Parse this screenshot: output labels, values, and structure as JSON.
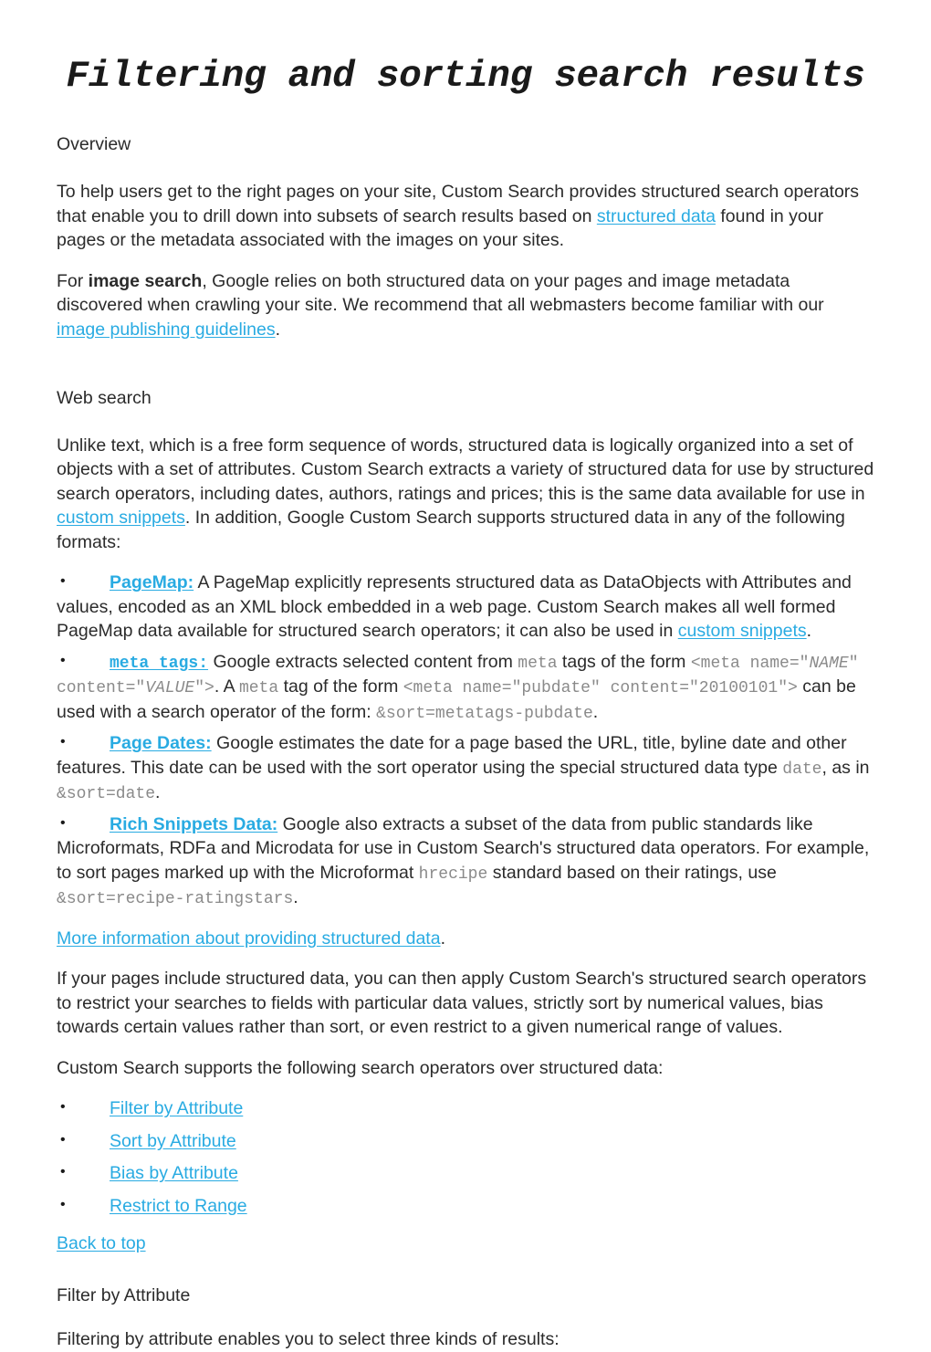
{
  "document": {
    "title": "Filtering and sorting search results"
  },
  "colors": {
    "link": "#29ABE2",
    "text": "#2b2b2b",
    "code": "#8a8a8a",
    "background": "#ffffff"
  },
  "sections": {
    "overview": {
      "heading": "Overview",
      "p1": {
        "a": "To help users get to the right pages on your site, Custom Search provides structured search operators that enable you to drill down into subsets of search results based on ",
        "link": "structured data",
        "b": " found in your pages or the metadata associated with the images on your sites."
      },
      "p2": {
        "a": "For ",
        "bold": "image search",
        "b": ", Google relies on both structured data on your pages and image metadata discovered when crawling your site. We recommend that all webmasters become familiar with our ",
        "link": "image publishing guidelines",
        "c": "."
      }
    },
    "web_search": {
      "heading": "Web search",
      "p1": {
        "a": "Unlike text, which is a free form sequence of words, structured data is logically organized into a set of objects with a set of attributes. Custom Search extracts a variety of structured data for use by structured search operators, including dates, authors, ratings and prices; this is the same data available for use in ",
        "link": "custom snippets",
        "b": ". In addition, Google Custom Search supports structured data in any of the following formats:"
      },
      "bullets": {
        "pagemap": {
          "link": "PageMap:",
          "a": " A PageMap explicitly represents structured data as DataObjects with Attributes and values, encoded as an XML block embedded in a web page. Custom Search makes all well formed PageMap data available for structured search operators; it can also be used in ",
          "link2": "custom snippets",
          "b": "."
        },
        "meta_tags": {
          "link": "meta tags:",
          "a": " Google extracts selected content from ",
          "code1": "meta",
          "b": " tags of the form ",
          "code2": "<meta name=\"",
          "code2i": "NAME",
          "code2b": "\" content=\"",
          "code2i2": "VALUE",
          "code2c": "\">",
          "c": ". A ",
          "code3": "meta",
          "d": " tag of the form ",
          "code4": "<meta name=\"pubdate\" content=\"20100101\">",
          "e": " can be used with a search operator of the form: ",
          "code5": "&sort=metatags-pubdate",
          "f": "."
        },
        "page_dates": {
          "link": "Page Dates:",
          "a": " Google estimates the date for a page based the URL, title, byline date and other features. This date can be used with the sort operator using the special structured data type ",
          "code1": "date",
          "b": ", as in ",
          "code2": "&sort=date",
          "c": "."
        },
        "rich_snippets": {
          "link": "Rich Snippets Data:",
          "a": " Google also extracts a subset of the data from public standards like Microformats, RDFa and Microdata for use in Custom Search's structured data operators. For example, to sort pages marked up with the Microformat ",
          "code1": "hrecipe",
          "b": " standard based on their ratings, use ",
          "code2": "&sort=recipe-ratingstars",
          "c": "."
        }
      },
      "more_info": {
        "link": "More information about providing structured data",
        "after": "."
      },
      "p2": "If your pages include structured data, you can then apply Custom Search's structured search operators to restrict your searches to fields with particular data values, strictly sort by numerical values, bias towards certain values rather than sort, or even restrict to a given numerical range of values.",
      "p3": "Custom Search supports the following search operators over structured data:",
      "operator_links": [
        "Filter by Attribute",
        "Sort by Attribute",
        "Bias by Attribute",
        "Restrict to Range"
      ],
      "back_to_top": "Back to top"
    },
    "filter_by_attribute": {
      "heading": "Filter by Attribute",
      "p1": "Filtering by attribute enables you to select three kinds of results:"
    }
  }
}
